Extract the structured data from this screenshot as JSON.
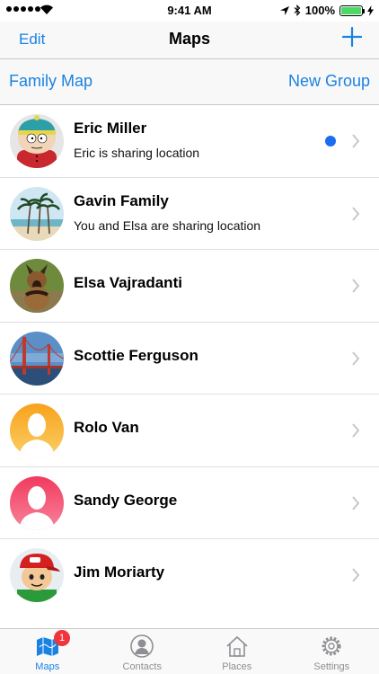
{
  "status_bar": {
    "time": "9:41 AM",
    "battery": "100%",
    "battery_level": 1.0
  },
  "nav": {
    "edit": "Edit",
    "title": "Maps",
    "add_icon": "plus-icon"
  },
  "groups": {
    "left": "Family Map",
    "right": "New Group"
  },
  "contacts": [
    {
      "name": "Eric Miller",
      "status": "Eric is sharing location",
      "unread": true,
      "avatar": "cartoon-avatar"
    },
    {
      "name": "Gavin Family",
      "status": "You and Elsa are sharing location",
      "unread": false,
      "avatar": "palm-tree-avatar"
    },
    {
      "name": "Elsa Vajradanti",
      "status": "",
      "unread": false,
      "avatar": "dog-avatar"
    },
    {
      "name": "Scottie Ferguson",
      "status": "",
      "unread": false,
      "avatar": "bridge-avatar"
    },
    {
      "name": "Rolo Van",
      "status": "",
      "unread": false,
      "avatar": "placeholder-avatar-orange"
    },
    {
      "name": "Sandy George",
      "status": "",
      "unread": false,
      "avatar": "placeholder-avatar-pink"
    },
    {
      "name": "Jim Moriarty",
      "status": "",
      "unread": false,
      "avatar": "toy-figure-avatar"
    }
  ],
  "tabs": [
    {
      "label": "Maps",
      "icon": "map-icon",
      "badge": "1",
      "active": true
    },
    {
      "label": "Contacts",
      "icon": "contacts-icon",
      "badge": "",
      "active": false
    },
    {
      "label": "Places",
      "icon": "home-icon",
      "badge": "",
      "active": false
    },
    {
      "label": "Settings",
      "icon": "settings-gear-icon",
      "badge": "",
      "active": false
    }
  ],
  "colors": {
    "accent": "#1a82e2",
    "unread_dot": "#1a6cf2",
    "badge": "#f0343c",
    "battery": "#4cd964"
  }
}
